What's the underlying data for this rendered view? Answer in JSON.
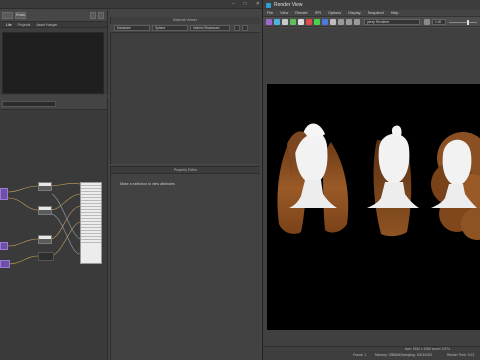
{
  "hypershade": {
    "title": "",
    "toolbar_button": "Rows",
    "tabs": [
      "Lite",
      "Projects",
      "Asset Hanger"
    ]
  },
  "attribute_editor": {
    "title": "Material Viewer",
    "dropdown1": "Hardware",
    "dropdown2": "Sphere",
    "dropdown3": "Indirect Shadowed"
  },
  "property_editor": {
    "title": "Property Editor",
    "hint": "Make a selection to view attributes"
  },
  "render_view": {
    "title": "Render View",
    "menus": [
      "File",
      "View",
      "Render",
      "IPR",
      "Options",
      "Display",
      "Snapshot",
      "Help"
    ],
    "camera_dropdown": "persp Renderer",
    "exposure_value": "1.00",
    "exposure_level": 0.7,
    "status": {
      "size": "size: 1920 x 1080  zoom: 0.574",
      "frame": "Frame: 1",
      "memory": "Memory: 3958Mb",
      "sampling": "Sampling: 3/3/3/3/3/2",
      "render_time": "Render Time: 0:13"
    }
  },
  "colors": {
    "accent_purple": "#6f4fa8",
    "hair_brown": "#8a4f22",
    "mannequin_white": "#f2f2f2",
    "render_bg": "#000000"
  }
}
